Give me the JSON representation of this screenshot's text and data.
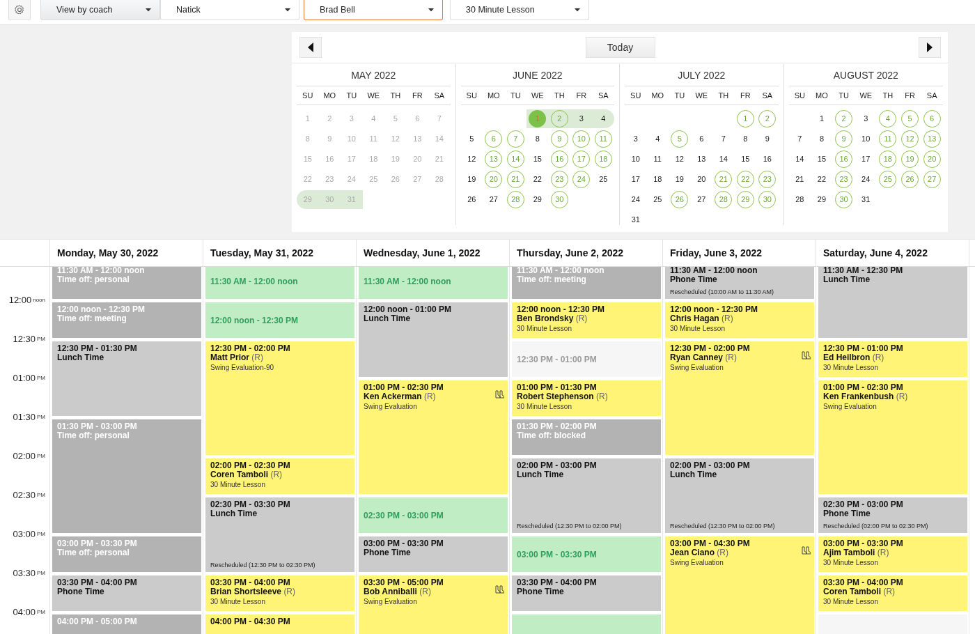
{
  "toolbar": {
    "selects": [
      {
        "value": "View by coach",
        "kind": "mode",
        "focused": false
      },
      {
        "value": "Natick",
        "kind": "filter",
        "focused": false
      },
      {
        "value": "Brad Bell",
        "kind": "filter",
        "focused": true
      },
      {
        "value": "30 Minute Lesson",
        "kind": "filter",
        "focused": false
      }
    ]
  },
  "calendar": {
    "today_button": "Today",
    "months": [
      {
        "title": "MAY 2022",
        "weekdays": [
          "SU",
          "MO",
          "TU",
          "WE",
          "TH",
          "FR",
          "SA"
        ],
        "weeks": [
          {
            "highlighted": false,
            "days": [
              {
                "d": "1",
                "kind": "disabled"
              },
              {
                "d": "2",
                "kind": "disabled"
              },
              {
                "d": "3",
                "kind": "disabled"
              },
              {
                "d": "4",
                "kind": "disabled"
              },
              {
                "d": "5",
                "kind": "disabled"
              },
              {
                "d": "6",
                "kind": "disabled"
              },
              {
                "d": "7",
                "kind": "disabled"
              }
            ]
          },
          {
            "highlighted": false,
            "days": [
              {
                "d": "8",
                "kind": "disabled"
              },
              {
                "d": "9",
                "kind": "disabled"
              },
              {
                "d": "10",
                "kind": "disabled"
              },
              {
                "d": "11",
                "kind": "disabled"
              },
              {
                "d": "12",
                "kind": "disabled"
              },
              {
                "d": "13",
                "kind": "disabled"
              },
              {
                "d": "14",
                "kind": "disabled"
              }
            ]
          },
          {
            "highlighted": false,
            "days": [
              {
                "d": "15",
                "kind": "disabled"
              },
              {
                "d": "16",
                "kind": "disabled"
              },
              {
                "d": "17",
                "kind": "disabled"
              },
              {
                "d": "18",
                "kind": "disabled"
              },
              {
                "d": "19",
                "kind": "disabled"
              },
              {
                "d": "20",
                "kind": "disabled"
              },
              {
                "d": "21",
                "kind": "disabled"
              }
            ]
          },
          {
            "highlighted": false,
            "days": [
              {
                "d": "22",
                "kind": "disabled"
              },
              {
                "d": "23",
                "kind": "disabled"
              },
              {
                "d": "24",
                "kind": "disabled"
              },
              {
                "d": "25",
                "kind": "disabled"
              },
              {
                "d": "26",
                "kind": "disabled"
              },
              {
                "d": "27",
                "kind": "disabled"
              },
              {
                "d": "28",
                "kind": "disabled"
              }
            ]
          },
          {
            "highlighted": true,
            "days": [
              {
                "d": "29",
                "kind": "disabled"
              },
              {
                "d": "30",
                "kind": "disabled"
              },
              {
                "d": "31",
                "kind": "disabled"
              }
            ]
          }
        ]
      },
      {
        "title": "JUNE 2022",
        "weekdays": [
          "SU",
          "MO",
          "TU",
          "WE",
          "TH",
          "FR",
          "SA"
        ],
        "weeks": [
          {
            "highlighted": true,
            "days": [
              {
                "d": "1",
                "kind": "today"
              },
              {
                "d": "2",
                "kind": "available"
              },
              {
                "d": "3",
                "kind": "plain"
              },
              {
                "d": "4",
                "kind": "plain"
              }
            ]
          },
          {
            "highlighted": false,
            "days": [
              {
                "d": "5",
                "kind": "plain"
              },
              {
                "d": "6",
                "kind": "available"
              },
              {
                "d": "7",
                "kind": "available"
              },
              {
                "d": "8",
                "kind": "plain"
              },
              {
                "d": "9",
                "kind": "available"
              },
              {
                "d": "10",
                "kind": "available"
              },
              {
                "d": "11",
                "kind": "available"
              }
            ]
          },
          {
            "highlighted": false,
            "days": [
              {
                "d": "12",
                "kind": "plain"
              },
              {
                "d": "13",
                "kind": "available"
              },
              {
                "d": "14",
                "kind": "available"
              },
              {
                "d": "15",
                "kind": "plain"
              },
              {
                "d": "16",
                "kind": "available"
              },
              {
                "d": "17",
                "kind": "available"
              },
              {
                "d": "18",
                "kind": "available"
              }
            ]
          },
          {
            "highlighted": false,
            "days": [
              {
                "d": "19",
                "kind": "plain"
              },
              {
                "d": "20",
                "kind": "available"
              },
              {
                "d": "21",
                "kind": "available"
              },
              {
                "d": "22",
                "kind": "plain"
              },
              {
                "d": "23",
                "kind": "available"
              },
              {
                "d": "24",
                "kind": "available"
              },
              {
                "d": "25",
                "kind": "plain"
              }
            ]
          },
          {
            "highlighted": false,
            "days": [
              {
                "d": "26",
                "kind": "plain"
              },
              {
                "d": "27",
                "kind": "plain"
              },
              {
                "d": "28",
                "kind": "available"
              },
              {
                "d": "29",
                "kind": "plain"
              },
              {
                "d": "30",
                "kind": "available"
              }
            ]
          }
        ]
      },
      {
        "title": "JULY 2022",
        "weekdays": [
          "SU",
          "MO",
          "TU",
          "WE",
          "TH",
          "FR",
          "SA"
        ],
        "weeks": [
          {
            "highlighted": false,
            "days": [
              {
                "d": "1",
                "kind": "available"
              },
              {
                "d": "2",
                "kind": "available"
              }
            ]
          },
          {
            "highlighted": false,
            "days": [
              {
                "d": "3",
                "kind": "plain"
              },
              {
                "d": "4",
                "kind": "plain"
              },
              {
                "d": "5",
                "kind": "available"
              },
              {
                "d": "6",
                "kind": "plain"
              },
              {
                "d": "7",
                "kind": "plain"
              },
              {
                "d": "8",
                "kind": "plain"
              },
              {
                "d": "9",
                "kind": "plain"
              }
            ]
          },
          {
            "highlighted": false,
            "days": [
              {
                "d": "10",
                "kind": "plain"
              },
              {
                "d": "11",
                "kind": "plain"
              },
              {
                "d": "12",
                "kind": "plain"
              },
              {
                "d": "13",
                "kind": "plain"
              },
              {
                "d": "14",
                "kind": "plain"
              },
              {
                "d": "15",
                "kind": "plain"
              },
              {
                "d": "16",
                "kind": "plain"
              }
            ]
          },
          {
            "highlighted": false,
            "days": [
              {
                "d": "17",
                "kind": "plain"
              },
              {
                "d": "18",
                "kind": "plain"
              },
              {
                "d": "19",
                "kind": "plain"
              },
              {
                "d": "20",
                "kind": "plain"
              },
              {
                "d": "21",
                "kind": "available"
              },
              {
                "d": "22",
                "kind": "available"
              },
              {
                "d": "23",
                "kind": "available"
              }
            ]
          },
          {
            "highlighted": false,
            "days": [
              {
                "d": "24",
                "kind": "plain"
              },
              {
                "d": "25",
                "kind": "plain"
              },
              {
                "d": "26",
                "kind": "available"
              },
              {
                "d": "27",
                "kind": "plain"
              },
              {
                "d": "28",
                "kind": "available"
              },
              {
                "d": "29",
                "kind": "available"
              },
              {
                "d": "30",
                "kind": "available"
              }
            ]
          },
          {
            "highlighted": false,
            "days": [
              {
                "d": "31",
                "kind": "plain"
              }
            ]
          }
        ]
      },
      {
        "title": "AUGUST 2022",
        "weekdays": [
          "SU",
          "MO",
          "TU",
          "WE",
          "TH",
          "FR",
          "SA"
        ],
        "weeks": [
          {
            "highlighted": false,
            "days": [
              {
                "d": "1",
                "kind": "plain"
              },
              {
                "d": "2",
                "kind": "available"
              },
              {
                "d": "3",
                "kind": "plain"
              },
              {
                "d": "4",
                "kind": "available"
              },
              {
                "d": "5",
                "kind": "available"
              },
              {
                "d": "6",
                "kind": "available"
              }
            ]
          },
          {
            "highlighted": false,
            "days": [
              {
                "d": "7",
                "kind": "plain"
              },
              {
                "d": "8",
                "kind": "plain"
              },
              {
                "d": "9",
                "kind": "available"
              },
              {
                "d": "10",
                "kind": "plain"
              },
              {
                "d": "11",
                "kind": "available"
              },
              {
                "d": "12",
                "kind": "available"
              },
              {
                "d": "13",
                "kind": "available"
              }
            ]
          },
          {
            "highlighted": false,
            "days": [
              {
                "d": "14",
                "kind": "plain"
              },
              {
                "d": "15",
                "kind": "plain"
              },
              {
                "d": "16",
                "kind": "available"
              },
              {
                "d": "17",
                "kind": "plain"
              },
              {
                "d": "18",
                "kind": "available"
              },
              {
                "d": "19",
                "kind": "available"
              },
              {
                "d": "20",
                "kind": "available"
              }
            ]
          },
          {
            "highlighted": false,
            "days": [
              {
                "d": "21",
                "kind": "plain"
              },
              {
                "d": "22",
                "kind": "plain"
              },
              {
                "d": "23",
                "kind": "available"
              },
              {
                "d": "24",
                "kind": "plain"
              },
              {
                "d": "25",
                "kind": "available"
              },
              {
                "d": "26",
                "kind": "available"
              },
              {
                "d": "27",
                "kind": "available"
              }
            ]
          },
          {
            "highlighted": false,
            "days": [
              {
                "d": "28",
                "kind": "plain"
              },
              {
                "d": "29",
                "kind": "plain"
              },
              {
                "d": "30",
                "kind": "available"
              },
              {
                "d": "31",
                "kind": "plain"
              }
            ]
          }
        ]
      }
    ]
  },
  "schedule": {
    "times": [
      {
        "time": "12:00",
        "suffix": "noon"
      },
      {
        "time": "12:30",
        "suffix": "PM"
      },
      {
        "time": "01:00",
        "suffix": "PM"
      },
      {
        "time": "01:30",
        "suffix": "PM"
      },
      {
        "time": "02:00",
        "suffix": "PM"
      },
      {
        "time": "02:30",
        "suffix": "PM"
      },
      {
        "time": "03:00",
        "suffix": "PM"
      },
      {
        "time": "03:30",
        "suffix": "PM"
      },
      {
        "time": "04:00",
        "suffix": "PM"
      }
    ],
    "days": [
      {
        "heading": "Monday, May 30, 2022",
        "events": [
          {
            "kind": "timeoff",
            "time": "11:30 AM - 12:00 noon",
            "title": "Time off: personal"
          },
          {
            "kind": "timeoff",
            "time": "12:00 noon - 12:30 PM",
            "title": "Time off: meeting"
          },
          {
            "kind": "block",
            "time": "12:30 PM - 01:30 PM",
            "title": "Lunch Time"
          },
          {
            "kind": "timeoff",
            "time": "01:30 PM - 03:00 PM",
            "title": "Time off: personal"
          },
          {
            "kind": "timeoff",
            "time": "03:00 PM - 03:30 PM",
            "title": "Time off: personal"
          },
          {
            "kind": "block",
            "time": "03:30 PM - 04:00 PM",
            "title": "Phone Time"
          },
          {
            "kind": "timeoff",
            "time": "04:00 PM - 05:00 PM"
          }
        ]
      },
      {
        "heading": "Tuesday, May 31, 2022",
        "events": [
          {
            "kind": "open",
            "time": "11:30 AM - 12:00 noon"
          },
          {
            "kind": "open",
            "time": "12:00 noon - 12:30 PM"
          },
          {
            "kind": "lesson",
            "time": "12:30 PM - 02:00 PM",
            "client": "Matt Prior",
            "tag": "(R)",
            "lesson": "Swing Evaluation-90",
            "icon": false
          },
          {
            "kind": "lesson",
            "time": "02:00 PM - 02:30 PM",
            "client": "Coren Tamboli",
            "tag": "(R)",
            "lesson": "30 Minute Lesson",
            "icon": false
          },
          {
            "kind": "block",
            "time": "02:30 PM - 03:30 PM",
            "title": "Lunch Time",
            "note": "Rescheduled (12:30 PM to 02:30 PM)"
          },
          {
            "kind": "lesson",
            "time": "03:30 PM - 04:00 PM",
            "client": "Brian Shortsleeve",
            "tag": "(R)",
            "lesson": "30 Minute Lesson",
            "icon": false
          },
          {
            "kind": "lesson",
            "time": "04:00 PM - 04:30 PM",
            "icon": false
          }
        ]
      },
      {
        "heading": "Wednesday, June 1, 2022",
        "events": [
          {
            "kind": "open",
            "time": "11:30 AM - 12:00 noon"
          },
          {
            "kind": "block",
            "time": "12:00 noon - 01:00 PM",
            "title": "Lunch Time"
          },
          {
            "kind": "lesson",
            "time": "01:00 PM - 02:30 PM",
            "client": "Ken Ackerman",
            "tag": "(R)",
            "lesson": "Swing Evaluation",
            "icon": true
          },
          {
            "kind": "open",
            "time": "02:30 PM - 03:00 PM"
          },
          {
            "kind": "block",
            "time": "03:00 PM - 03:30 PM",
            "title": "Phone Time"
          },
          {
            "kind": "lesson",
            "time": "03:30 PM - 05:00 PM",
            "client": "Bob Anniballi",
            "tag": "(R)",
            "lesson": "Swing Evaluation",
            "icon": true
          }
        ]
      },
      {
        "heading": "Thursday, June 2, 2022",
        "events": [
          {
            "kind": "timeoff",
            "time": "11:30 AM - 12:00 noon",
            "title": "Time off: meeting"
          },
          {
            "kind": "lesson",
            "time": "12:00 noon - 12:30 PM",
            "client": "Ben Brondsky",
            "tag": "(R)",
            "lesson": "30 Minute Lesson",
            "icon": false
          },
          {
            "kind": "past",
            "time": "12:30 PM - 01:00 PM"
          },
          {
            "kind": "lesson",
            "time": "01:00 PM - 01:30 PM",
            "client": "Robert Stephenson",
            "tag": "(R)",
            "lesson": "30 Minute Lesson",
            "icon": false
          },
          {
            "kind": "timeoff",
            "time": "01:30 PM - 02:00 PM",
            "title": "Time off: blocked"
          },
          {
            "kind": "block",
            "time": "02:00 PM - 03:00 PM",
            "title": "Lunch Time",
            "note": "Rescheduled (12:30 PM to 02:00 PM)"
          },
          {
            "kind": "open",
            "time": "03:00 PM - 03:30 PM"
          },
          {
            "kind": "block",
            "time": "03:30 PM - 04:00 PM",
            "title": "Phone Time"
          },
          {
            "kind": "open"
          }
        ]
      },
      {
        "heading": "Friday, June 3, 2022",
        "events": [
          {
            "kind": "block",
            "time": "11:30 AM - 12:00 noon",
            "title": "Phone Time",
            "note": "Rescheduled (10:00 AM to 11:30 AM)"
          },
          {
            "kind": "lesson",
            "time": "12:00 noon - 12:30 PM",
            "client": "Chris Hagan",
            "tag": "(R)",
            "lesson": "30 Minute Lesson",
            "icon": false
          },
          {
            "kind": "lesson",
            "time": "12:30 PM - 02:00 PM",
            "client": "Ryan Canney",
            "tag": "(R)",
            "lesson": "Swing Evaluation",
            "icon": true
          },
          {
            "kind": "block",
            "time": "02:00 PM - 03:00 PM",
            "title": "Lunch Time",
            "note": "Rescheduled (12:30 PM to 02:00 PM)"
          },
          {
            "kind": "lesson",
            "time": "03:00 PM - 04:30 PM",
            "client": "Jean Ciano",
            "tag": "(R)",
            "lesson": "Swing Evaluation",
            "icon": true
          }
        ]
      },
      {
        "heading": "Saturday, June 4, 2022",
        "events": [
          {
            "kind": "block",
            "time": "11:30 AM - 12:30 PM",
            "title": "Lunch Time"
          },
          {
            "kind": "lesson",
            "time": "12:30 PM - 01:00 PM",
            "client": "Ed Heilbron",
            "tag": "(R)",
            "lesson": "30 Minute Lesson",
            "icon": false
          },
          {
            "kind": "lesson",
            "time": "01:00 PM - 02:30 PM",
            "client": "Ken Frankenbush",
            "tag": "(R)",
            "lesson": "Swing Evaluation",
            "icon": false
          },
          {
            "kind": "block",
            "time": "02:30 PM - 03:00 PM",
            "title": "Phone Time",
            "note": "Rescheduled (02:00 PM to 02:30 PM)"
          },
          {
            "kind": "lesson",
            "time": "03:00 PM - 03:30 PM",
            "client": "Ajim Tamboli",
            "tag": "(R)",
            "lesson": "30 Minute Lesson",
            "icon": false
          },
          {
            "kind": "lesson",
            "time": "03:30 PM - 04:00 PM",
            "client": "Coren Tamboli",
            "tag": "(R)",
            "lesson": "30 Minute Lesson",
            "icon": false
          },
          {
            "kind": "past"
          }
        ]
      }
    ]
  }
}
